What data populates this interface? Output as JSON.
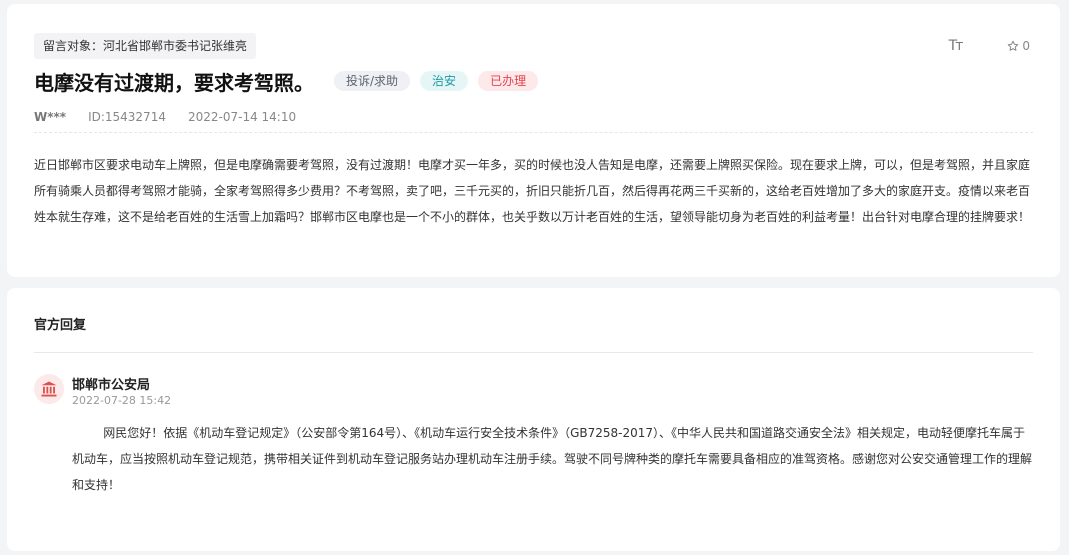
{
  "message": {
    "target": "留言对象：河北省邯郸市委书记张维亮",
    "title": "电摩没有过渡期，要求考驾照。",
    "tags": [
      {
        "label": "投诉/求助",
        "color": "#5c6470"
      },
      {
        "label": "治安",
        "color": "#1f9aa5"
      },
      {
        "label": "已办理",
        "color": "#e5434f"
      }
    ],
    "author": "W***",
    "id": "ID:15432714",
    "time": "2022-07-14 14:10",
    "font_tool_label": "Tт",
    "star_count": "0",
    "content": "近日邯郸市区要求电动车上牌照，但是电摩确需要考驾照，没有过渡期！电摩才买一年多，买的时候也没人告知是电摩，还需要上牌照买保险。现在要求上牌，可以，但是考驾照，并且家庭所有骑乘人员都得考驾照才能骑，全家考驾照得多少费用？不考驾照，卖了吧，三千元买的，折旧只能折几百，然后得再花两三千买新的，这给老百姓增加了多大的家庭开支。疫情以来老百姓本就生存难，这不是给老百姓的生活雪上加霜吗？邯郸市区电摩也是一个不小的群体，也关乎数以万计老百姓的生活，望领导能切身为老百姓的利益考量！出台针对电摩合理的挂牌要求！"
  },
  "reply": {
    "heading": "官方回复",
    "department": "邯郸市公安局",
    "time": "2022-07-28 15:42",
    "content": "网民您好！依据《机动车登记规定》（公安部令第164号）、《机动车运行安全技术条件》（GB7258-2017）、《中华人民共和国道路交通安全法》相关规定，电动轻便摩托车属于机动车，应当按照机动车登记规范，携带相关证件到机动车登记服务站办理机动车注册手续。驾驶不同号牌种类的摩托车需要具备相应的准驾资格。感谢您对公安交通管理工作的理解和支持！"
  },
  "icons": {
    "font_size": "font-size-icon",
    "star": "star-outline-icon",
    "department": "government-building-icon"
  },
  "colors": {
    "accent_red": "#e5434f",
    "teal": "#1f9aa5",
    "icon_bg": "#fde9ea"
  }
}
